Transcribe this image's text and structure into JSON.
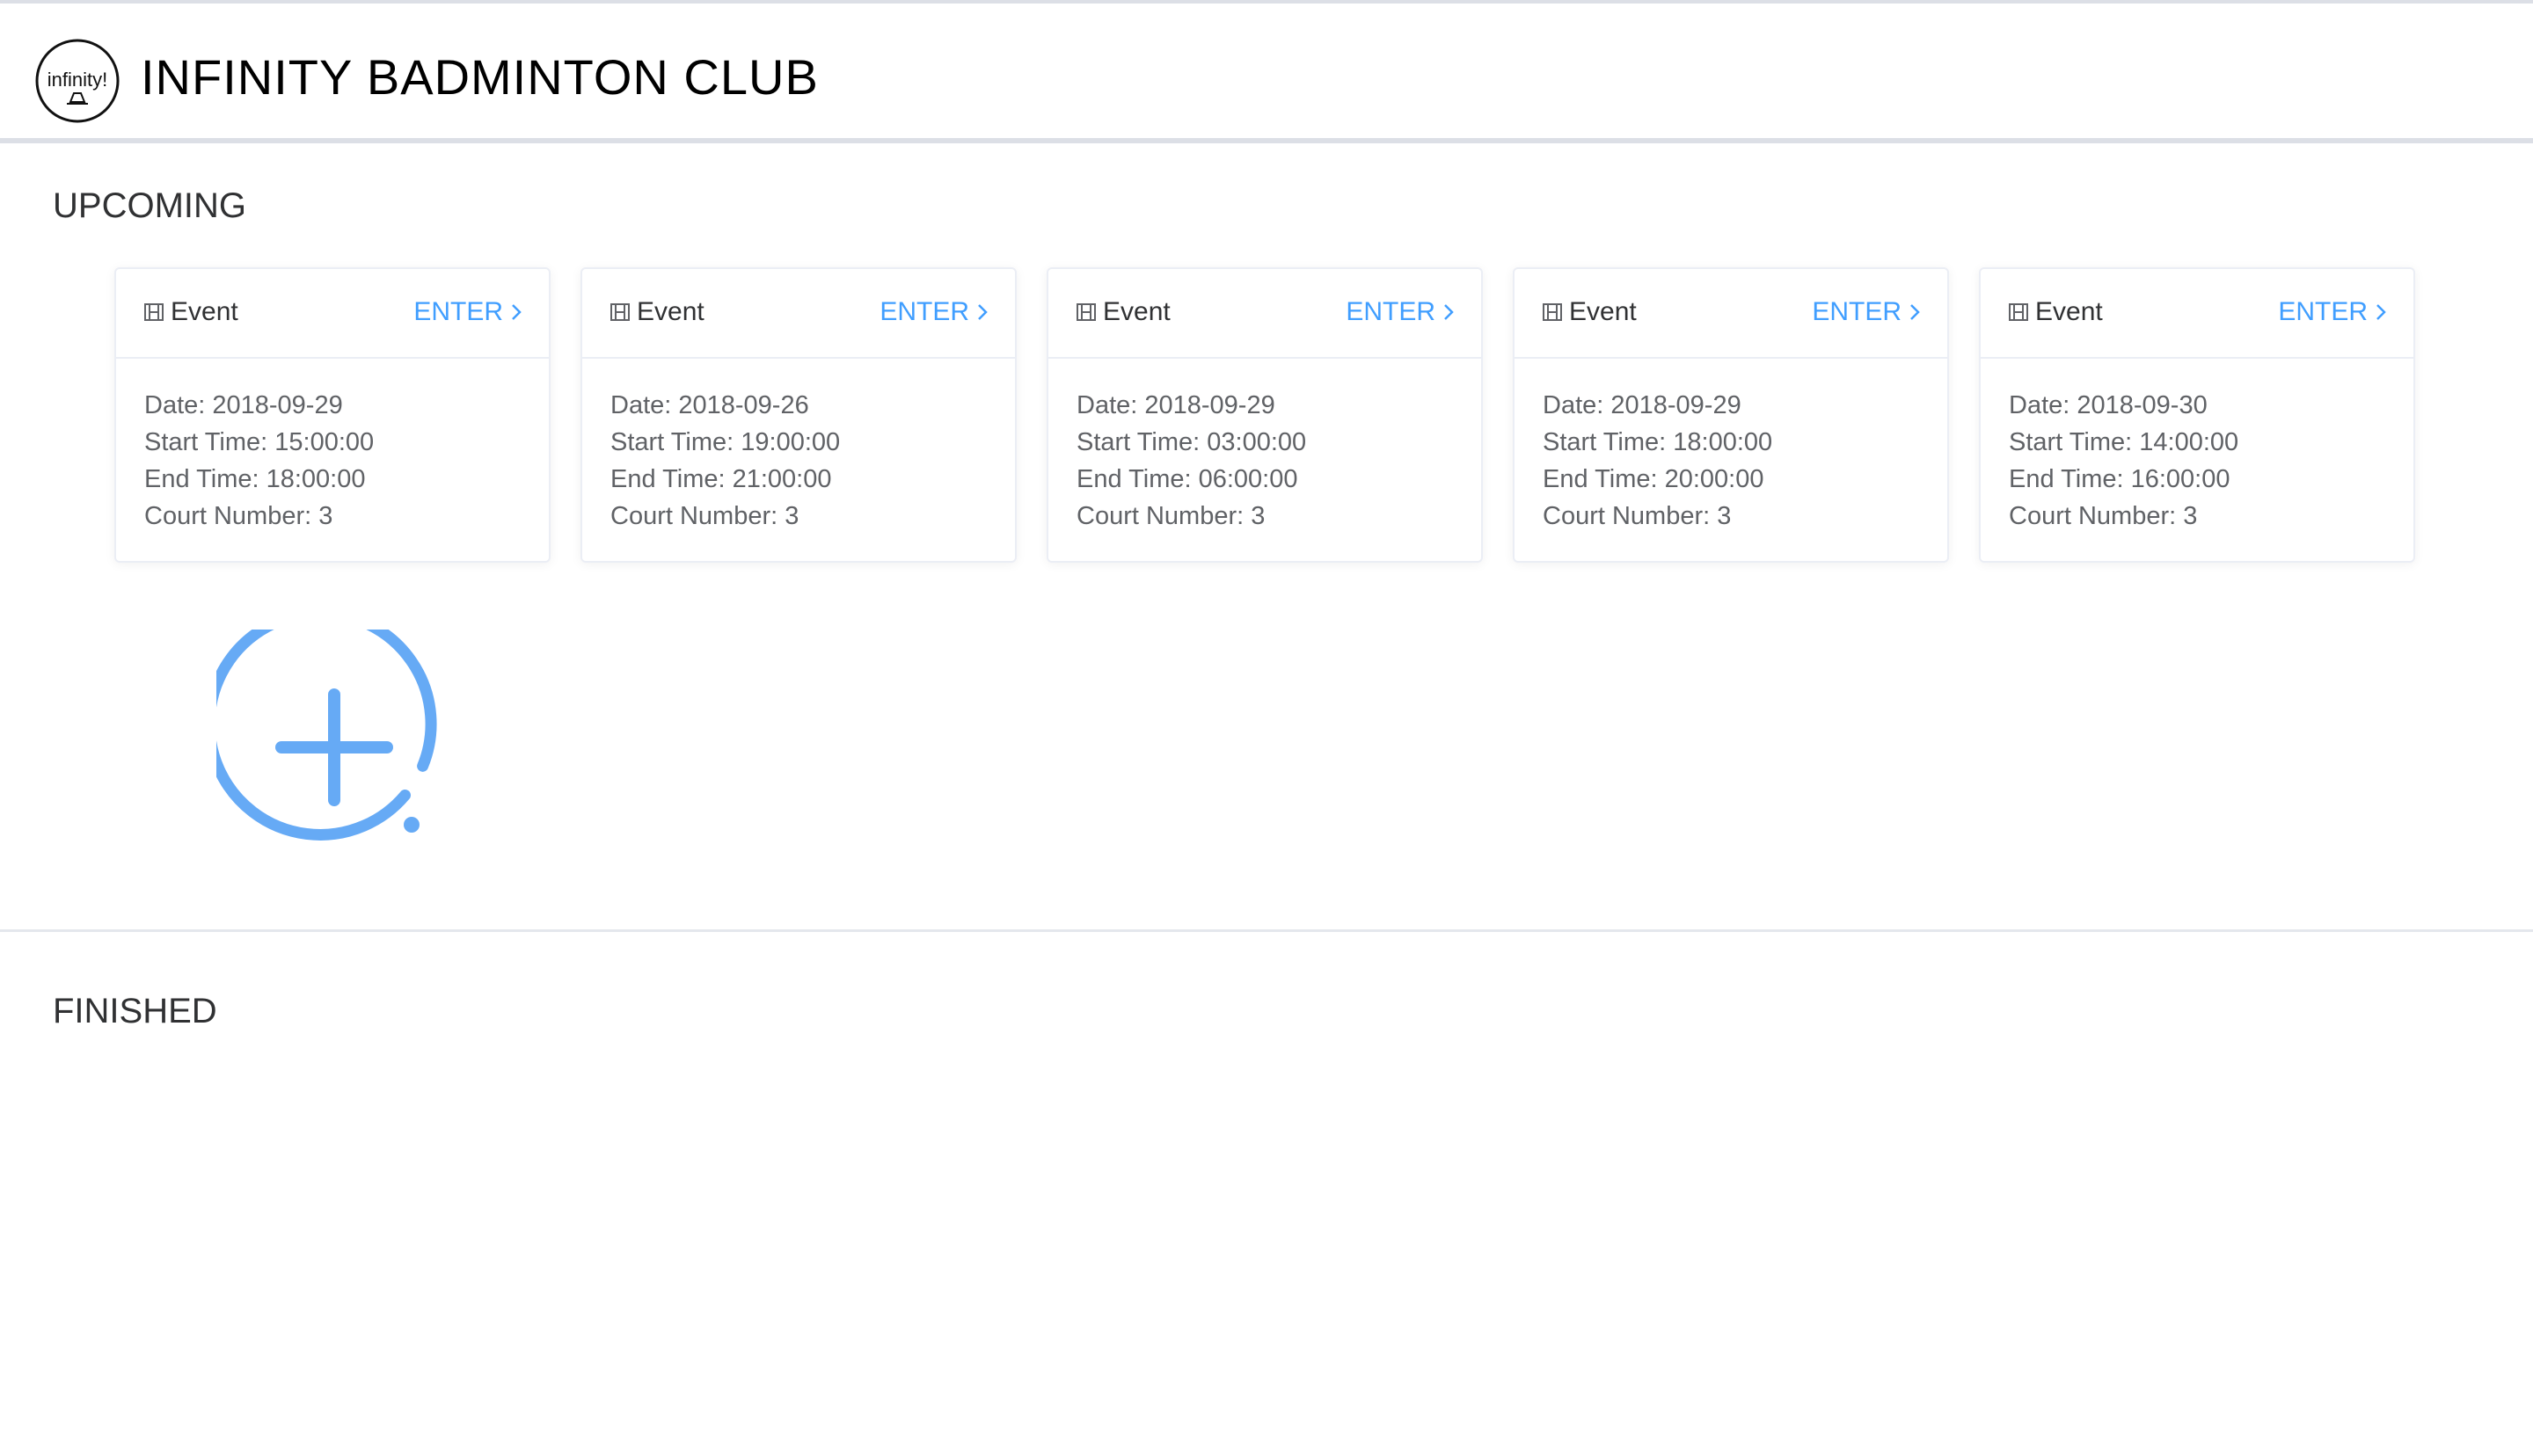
{
  "header": {
    "logo_text": "infinity!",
    "title": "INFINITY BADMINTON CLUB"
  },
  "sections": {
    "upcoming_title": "UPCOMING",
    "finished_title": "FINISHED"
  },
  "cards": [
    {
      "title": "Event",
      "enter_label": "ENTER",
      "date": "Date: 2018-09-29",
      "start": "Start Time: 15:00:00",
      "end": "End Time: 18:00:00",
      "court": "Court Number: 3"
    },
    {
      "title": "Event",
      "enter_label": "ENTER",
      "date": "Date: 2018-09-26",
      "start": "Start Time: 19:00:00",
      "end": "End Time: 21:00:00",
      "court": "Court Number: 3"
    },
    {
      "title": "Event",
      "enter_label": "ENTER",
      "date": "Date: 2018-09-29",
      "start": "Start Time: 03:00:00",
      "end": "End Time: 06:00:00",
      "court": "Court Number: 3"
    },
    {
      "title": "Event",
      "enter_label": "ENTER",
      "date": "Date: 2018-09-29",
      "start": "Start Time: 18:00:00",
      "end": "End Time: 20:00:00",
      "court": "Court Number: 3"
    },
    {
      "title": "Event",
      "enter_label": "ENTER",
      "date": "Date: 2018-09-30",
      "start": "Start Time: 14:00:00",
      "end": "End Time: 16:00:00",
      "court": "Court Number: 3"
    }
  ],
  "icons": {
    "card_icon": "film-icon",
    "enter_icon": "chevron-right-icon",
    "add_icon": "circle-plus-icon"
  },
  "colors": {
    "accent": "#409eff",
    "add_button": "#66aaf5"
  }
}
